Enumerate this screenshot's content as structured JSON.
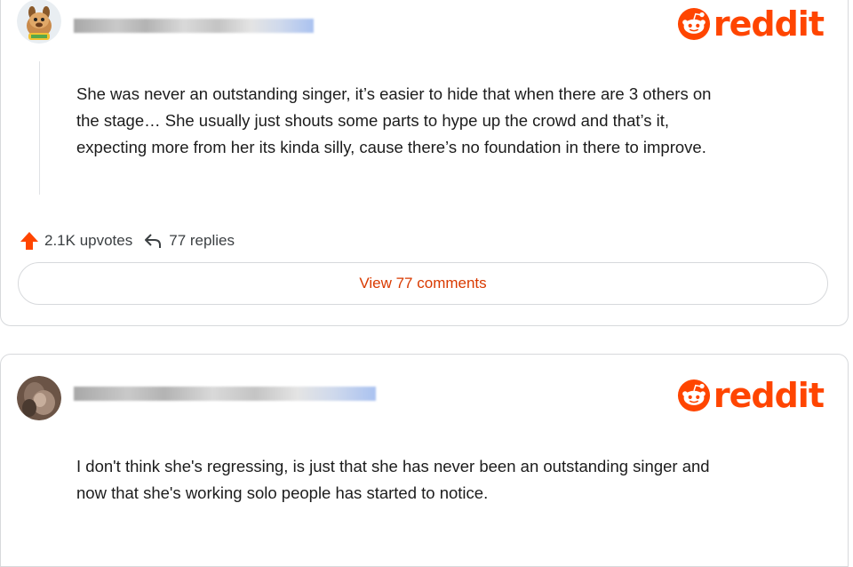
{
  "posts": [
    {
      "author_obscured": true,
      "body": "She was never an outstanding singer, it’s easier to hide that when there are 3 others on the stage… She usually just shouts some parts to hype up the crowd and that’s it, expecting more from her its kinda silly, cause there’s no foundation in there to improve.",
      "body_lines": [
        "She was never an outstanding singer, it’s easier to hide that when there are 3 others on",
        "the stage… She usually just shouts some parts to hype up the crowd and that’s it,",
        "expecting more from her its kinda silly, cause there’s no foundation in there to improve."
      ],
      "upvotes": "2.1K upvotes",
      "replies": "77 replies",
      "view_comments": "View 77 comments",
      "avatar_icon": "cartoon-avatar-icon"
    },
    {
      "author_obscured": true,
      "body_lines": [
        "I don't think she's regressing, is just that she has never been an outstanding singer and",
        "now that she's working solo people has started to notice."
      ],
      "avatar_icon": "photo-avatar-icon"
    }
  ],
  "brand": {
    "name": "reddit",
    "color": "#ff4500"
  },
  "colors": {
    "upvote": "#ff4500",
    "link": "#d93a00",
    "border": "#d7d9dc"
  }
}
